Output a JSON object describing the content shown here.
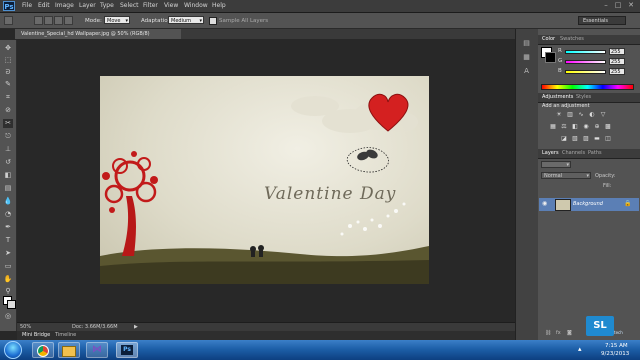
{
  "app": {
    "logo_text": "Ps"
  },
  "menu": {
    "items": [
      "File",
      "Edit",
      "Image",
      "Layer",
      "Type",
      "Select",
      "Filter",
      "View",
      "Window",
      "Help"
    ]
  },
  "window_controls": {
    "minimize": "–",
    "maximize": "□",
    "close": "✕"
  },
  "options_bar": {
    "mode_label": "Mode:",
    "mode_value": "Move",
    "adaptation_label": "Adaptation:",
    "adaptation_value": "Medium",
    "sample_all_layers": "Sample All Layers",
    "workspace": "Essentials"
  },
  "document": {
    "tab_title": "Valentine_Special_hd Wallpaper.jpg @ 50% (RGB/8)"
  },
  "artwork": {
    "title_text": "Valentine Day"
  },
  "status_bar": {
    "zoom": "50%",
    "doc_info": "Doc: 3.66M/3.66M"
  },
  "bottom_tabs": [
    "Mini Bridge",
    "Timeline"
  ],
  "panels": {
    "color_tabs": [
      "Color",
      "Swatches"
    ],
    "color_sliders": [
      {
        "letter": "R",
        "value": "255"
      },
      {
        "letter": "G",
        "value": "255"
      },
      {
        "letter": "B",
        "value": "255"
      }
    ],
    "adjustment_tabs": [
      "Adjustments",
      "Styles"
    ],
    "adjustment_heading": "Add an adjustment",
    "layers_tabs": [
      "Layers",
      "Channels",
      "Paths"
    ],
    "blend_mode": "Normal",
    "opacity_label": "Opacity:",
    "fill_label": "Fill:",
    "layer_name": "Background"
  },
  "taskbar": {
    "time": "7:15 AM",
    "date": "9/23/2013"
  },
  "watermark": {
    "logo": "SL",
    "sub": "tech"
  },
  "colors": {
    "accent_layer": "#5b7fb5",
    "heart": "#d42020",
    "taskbar": "#1d5fa8"
  }
}
